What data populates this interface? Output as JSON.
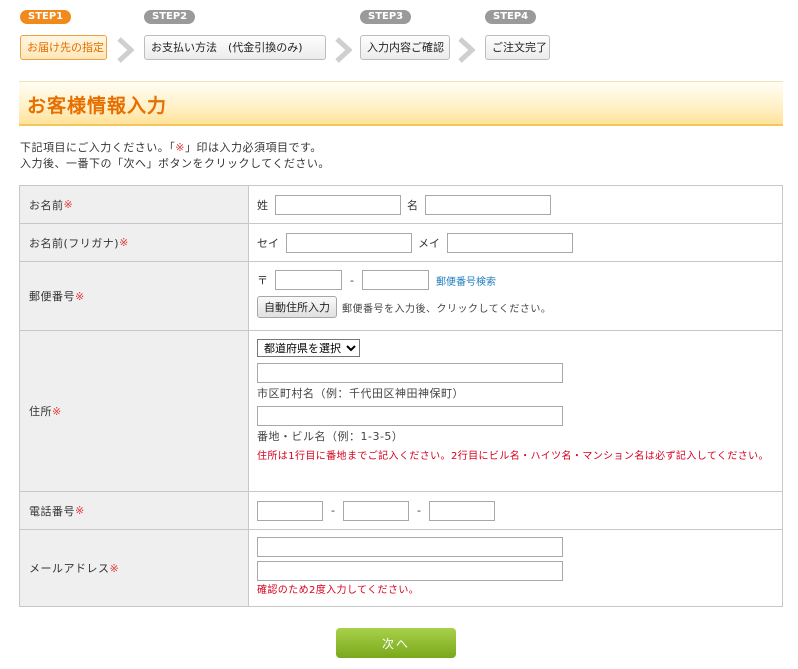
{
  "steps": [
    {
      "badge": "STEP1",
      "label": "お届け先の指定",
      "active": true
    },
    {
      "badge": "STEP2",
      "label": "お支払い方法　(代金引換のみ)",
      "active": false
    },
    {
      "badge": "STEP3",
      "label": "入力内容ご確認",
      "active": false
    },
    {
      "badge": "STEP4",
      "label": "ご注文完了",
      "active": false
    }
  ],
  "heading": "お客様情報入力",
  "intro": {
    "line1_before": "下記項目にご入力ください。「",
    "line1_mark": "※",
    "line1_after": "」印は入力必須項目です。",
    "line2": "入力後、一番下の「次へ」ボタンをクリックしてください。"
  },
  "required_mark": "※",
  "form": {
    "name": {
      "label": "お名前",
      "last_label": "姓",
      "first_label": "名",
      "last_value": "",
      "first_value": ""
    },
    "kana": {
      "label": "お名前(フリガナ)",
      "last_label": "セイ",
      "first_label": "メイ",
      "last_value": "",
      "first_value": ""
    },
    "postal": {
      "label": "郵便番号",
      "prefix": "〒",
      "dash": "-",
      "value1": "",
      "value2": "",
      "search_link": "郵便番号検索",
      "auto_button": "自動住所入力",
      "auto_hint": "郵便番号を入力後、クリックしてください。"
    },
    "address": {
      "label": "住所",
      "prefecture_selected": "都道府県を選択",
      "city_value": "",
      "city_hint": "市区町村名（例：千代田区神田神保町）",
      "street_value": "",
      "street_hint": "番地・ビル名（例：1-3-5）",
      "note": "住所は1行目に番地までご記入ください。2行目にビル名・ハイツ名・マンション名は必ず記入してください。"
    },
    "phone": {
      "label": "電話番号",
      "dash": "-",
      "value1": "",
      "value2": "",
      "value3": ""
    },
    "email": {
      "label": "メールアドレス",
      "value1": "",
      "value2": "",
      "note": "確認のため2度入力してください。"
    }
  },
  "next_button": "次へ",
  "colors": {
    "accent": "#f08a1c",
    "heading_text": "#e66f00",
    "required": "#e23b3b",
    "note": "#d6001c",
    "link": "#1f7fbf",
    "next_button": "#8fbd2f"
  }
}
